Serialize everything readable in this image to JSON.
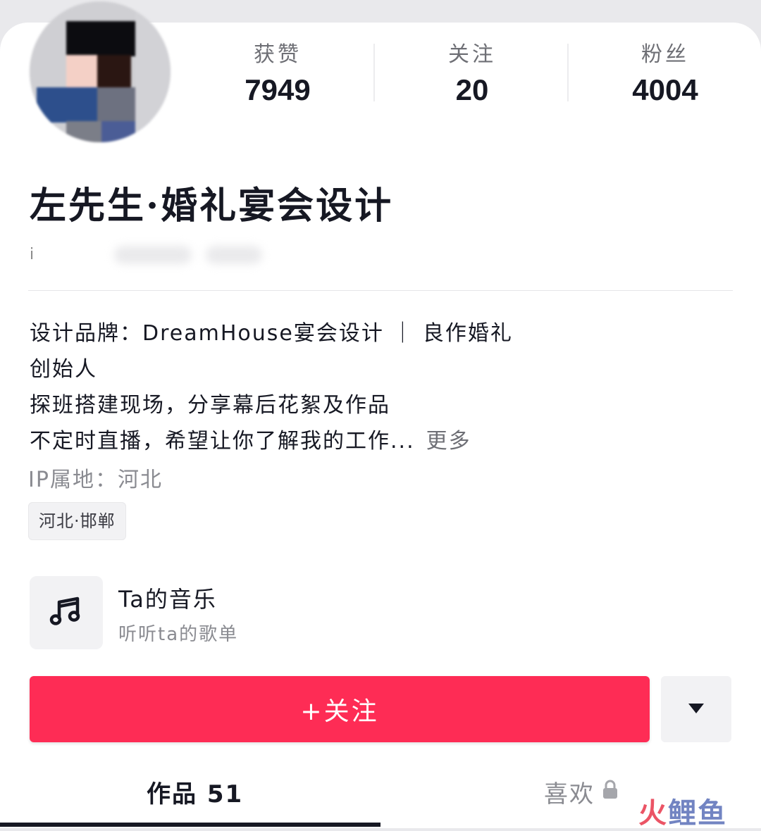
{
  "stats": [
    {
      "label": "获赞",
      "value": "7949"
    },
    {
      "label": "关注",
      "value": "20"
    },
    {
      "label": "粉丝",
      "value": "4004"
    }
  ],
  "profile": {
    "name": "左先生·婚礼宴会设计",
    "blurred_subtitle_glyph": "i"
  },
  "bio": {
    "lines": [
      "设计品牌：DreamHouse宴会设计 ｜ 良作婚礼",
      "创始人",
      "探班搭建现场，分享幕后花絮及作品",
      "不定时直播，希望让你了解我的工作..."
    ],
    "more_label": "更多"
  },
  "ip_location": "IP属地：河北",
  "location_tag": "河北·邯郸",
  "music": {
    "title": "Ta的音乐",
    "subtitle": "听听ta的歌单",
    "icon": "music-note-icon"
  },
  "actions": {
    "follow_label": "+关注",
    "dropdown_icon": "triangle-down-icon"
  },
  "tabs": [
    {
      "label": "作品 51",
      "active": true
    },
    {
      "label": "喜欢",
      "locked": true
    }
  ],
  "watermark": {
    "first": "火",
    "rest": "鲤鱼"
  },
  "colors": {
    "accent": "#fe2c55",
    "text_primary": "#161823",
    "text_secondary": "#8a8b91",
    "surface": "#f2f2f4"
  }
}
